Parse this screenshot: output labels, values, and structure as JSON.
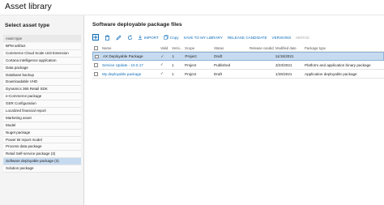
{
  "window": {
    "title": "Asset library"
  },
  "left_panel": {
    "heading": "Select asset type",
    "column_header": "Asset type",
    "items": [
      {
        "label": "BPM artifact"
      },
      {
        "label": "Commerce Cloud Scale Unit Extension"
      },
      {
        "label": "Cortana intelligence application"
      },
      {
        "label": "Data package"
      },
      {
        "label": "Database backup"
      },
      {
        "label": "Downloadable VHD"
      },
      {
        "label": "Dynamics 365 Retail SDK"
      },
      {
        "label": "e-Commerce package"
      },
      {
        "label": "GER Configuration"
      },
      {
        "label": "Localized financial report"
      },
      {
        "label": "Marketing asset"
      },
      {
        "label": "Model"
      },
      {
        "label": "Nuget package"
      },
      {
        "label": "Power BI report model"
      },
      {
        "label": "Process data package"
      },
      {
        "label": "Retail Self-service package (3)"
      },
      {
        "label": "Software deployable package (3)"
      },
      {
        "label": "Solution package"
      }
    ]
  },
  "right_panel": {
    "heading": "Software deployable package files",
    "toolbar": {
      "import": "IMPORT",
      "copy": "Copy",
      "save_to_library": "SAVE TO MY LIBRARY",
      "release_candidate": "RELEASE CANDIDATE",
      "versions": "VERSIONS",
      "merge": "MERGE"
    },
    "columns": {
      "name": "Name",
      "valid": "Valid",
      "version": "Versi...",
      "scope": "Scope",
      "status": "Status",
      "release_candidate": "Release candida...",
      "modified_date": "Modified date",
      "package_type": "Package type"
    },
    "rows": [
      {
        "name": "AX Deployable Package",
        "valid": "✓",
        "version": "1",
        "scope": "Project",
        "status": "Draft",
        "release_candidate": "",
        "modified_date": "11/15/2021",
        "package_type": ""
      },
      {
        "name": "Service Update - 10.0.17",
        "valid": "✓",
        "version": "1",
        "scope": "Project",
        "status": "Published",
        "release_candidate": "",
        "modified_date": "3/23/2021",
        "package_type": "Platform and application binary package"
      },
      {
        "name": "My deployable package",
        "valid": "✓",
        "version": "1",
        "scope": "Project",
        "status": "Draft",
        "release_candidate": "",
        "modified_date": "1/26/2021",
        "package_type": "Application deployable package"
      }
    ]
  },
  "colors": {
    "accent": "#0b6bb8",
    "selection": "#c7dbf0"
  },
  "icons": [
    "add-icon",
    "delete-icon",
    "edit-icon",
    "refresh-icon",
    "import-icon",
    "copy-icon"
  ]
}
